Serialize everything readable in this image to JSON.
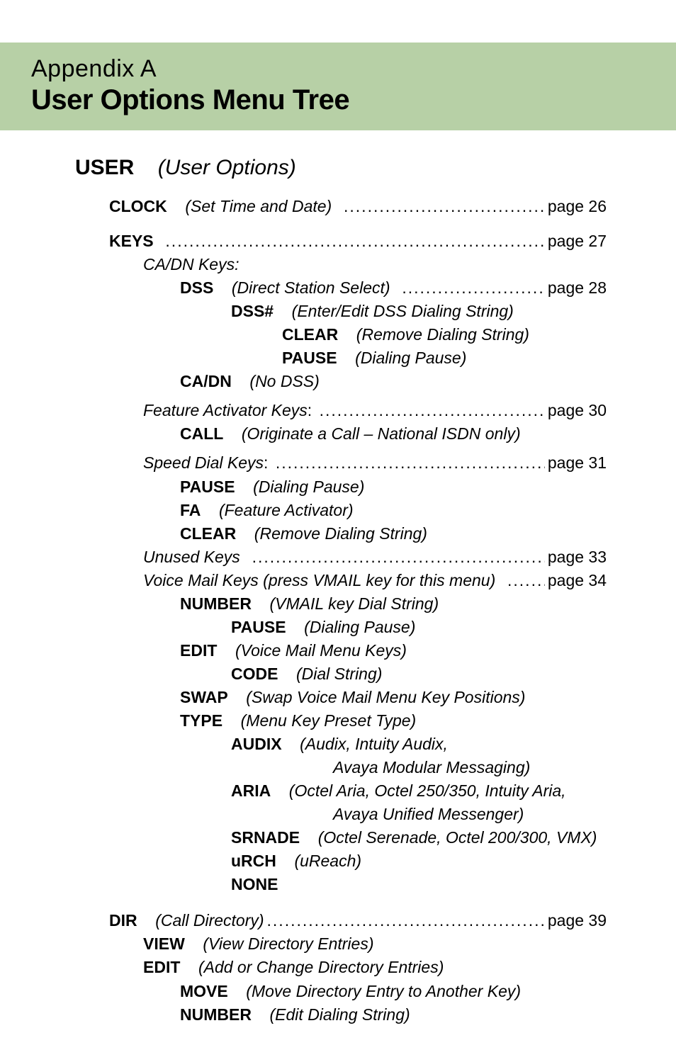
{
  "banner": {
    "appendix": "Appendix A",
    "title": "User Options Menu Tree"
  },
  "heading": {
    "user": "USER",
    "userDesc": "(User Options)"
  },
  "page_label": "page",
  "clock": {
    "label": "CLOCK",
    "desc": "(Set Time and Date)",
    "page": "page 26"
  },
  "keys": {
    "label": "KEYS",
    "page": "page 27",
    "cadn": "CA/DN Keys:",
    "dss": {
      "label": "DSS",
      "desc": "(Direct Station Select)",
      "page": "page 28"
    },
    "dssNum": {
      "label": "DSS#",
      "desc": "(Enter/Edit DSS Dialing String)"
    },
    "clear": {
      "label": "CLEAR",
      "desc": "(Remove Dialing String)"
    },
    "pause": {
      "label": "PAUSE",
      "desc": "(Dialing Pause)"
    },
    "cadnNoDss": {
      "label": "CA/DN",
      "desc": "(No DSS)"
    },
    "featureActivator": {
      "label": "Feature Activator Keys",
      "page": "page 30"
    },
    "call": {
      "label": "CALL",
      "desc": "(Originate a Call – National ISDN only)"
    },
    "speedDial": {
      "label": "Speed Dial Keys",
      "page": "page 31"
    },
    "sdPause": {
      "label": "PAUSE",
      "desc": "(Dialing Pause)"
    },
    "sdFA": {
      "label": "FA",
      "desc": "(Feature Activator)"
    },
    "sdClear": {
      "label": "CLEAR",
      "desc": "(Remove Dialing String)"
    },
    "unusedKeys": {
      "label": "Unused Keys",
      "page": "page 33"
    },
    "voiceMail": {
      "label": "Voice Mail Keys  (press VMAIL key for this menu)",
      "page": "page 34"
    },
    "number": {
      "label": "NUMBER",
      "desc": "(VMAIL key Dial String)"
    },
    "vmPause": {
      "label": "PAUSE",
      "desc": "(Dialing Pause)"
    },
    "edit": {
      "label": "EDIT",
      "desc": "(Voice Mail Menu Keys)"
    },
    "code": {
      "label": "CODE",
      "desc": "(Dial String)"
    },
    "swap": {
      "label": "SWAP",
      "desc": "(Swap Voice Mail Menu Key Positions)"
    },
    "type": {
      "label": "TYPE",
      "desc": "(Menu Key Preset Type)"
    },
    "audix": {
      "label": "AUDIX",
      "desc": "(Audix, Intuity Audix,"
    },
    "audix2": "Avaya Modular Messaging)",
    "aria": {
      "label": "ARIA",
      "desc": "(Octel Aria, Octel 250/350, Intuity Aria,"
    },
    "aria2": "Avaya Unified Messenger)",
    "srnade": {
      "label": "SRNADE",
      "desc": "(Octel Serenade, Octel 200/300, VMX)"
    },
    "urch": {
      "label": "uRCH",
      "desc": "(uReach)"
    },
    "none": {
      "label": "NONE"
    }
  },
  "dir": {
    "label": "DIR",
    "desc": "(Call Directory)",
    "page": "page 39",
    "view": {
      "label": "VIEW",
      "desc": "(View Directory Entries)"
    },
    "edit": {
      "label": "EDIT",
      "desc": "(Add or Change Directory Entries)"
    },
    "move": {
      "label": "MOVE",
      "desc": "(Move Directory Entry to Another Key)"
    },
    "number": {
      "label": "NUMBER",
      "desc": "(Edit Dialing String)"
    }
  }
}
